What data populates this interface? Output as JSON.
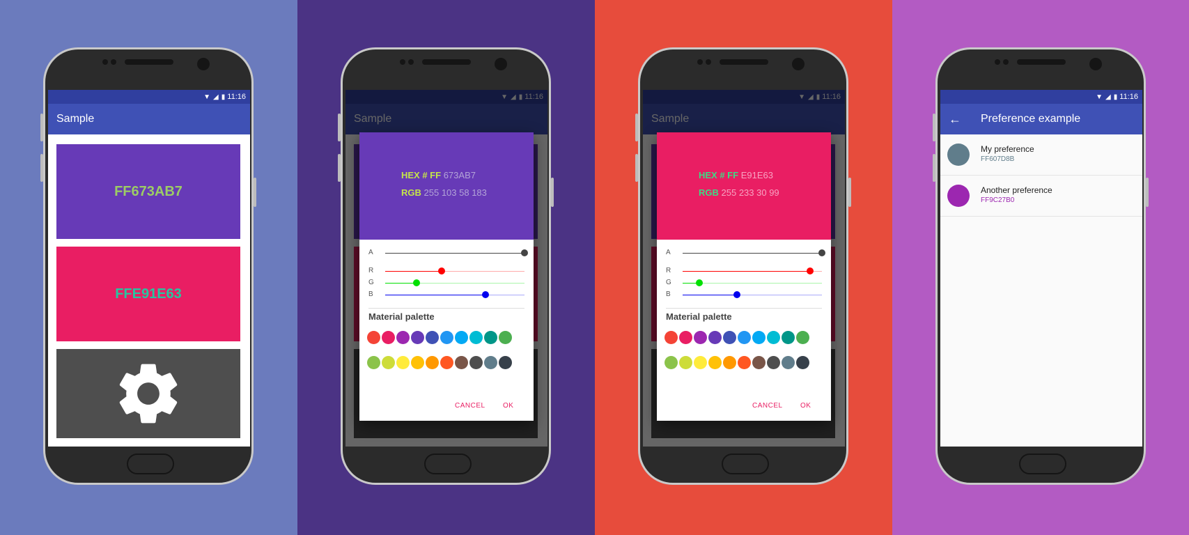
{
  "colors": {
    "bg": [
      "#6b7bbd",
      "#4b3384",
      "#e74c3c",
      "#b35bc3"
    ],
    "primary": "#3f51b5",
    "primary_dark": "#303f9f",
    "accent": "#e91e63",
    "slider_r": "#ff0000",
    "slider_g": "#00e000",
    "slider_b": "#0000ee",
    "slider_a": "#444444"
  },
  "status_bar": {
    "time": "11:16",
    "icons": [
      "wifi-icon",
      "signal-icon",
      "battery-icon"
    ]
  },
  "screen1": {
    "app_title": "Sample",
    "tiles": [
      {
        "label": "FF673AB7",
        "bg": "#673ab7",
        "text_color": "#9ccc65"
      },
      {
        "label": "FFE91E63",
        "bg": "#e91e63",
        "text_color": "#26c6a0"
      }
    ],
    "settings_tile": {
      "bg": "#4e4e4e",
      "icon": "gear-icon"
    }
  },
  "dialogs": [
    {
      "preview_bg": "#673ab7",
      "label_color": "#c4e54a",
      "value_color": "#b3a4d8",
      "hex_label": "HEX # FF",
      "hex_value": "673AB7",
      "rgb_label": "RGB",
      "rgb_value": "255 103 58 183",
      "sliders": {
        "A": 255,
        "R": 103,
        "G": 58,
        "B": 183
      },
      "slider_labels": [
        "A",
        "R",
        "G",
        "B"
      ],
      "palette_title": "Material palette",
      "cancel": "CANCEL",
      "ok": "OK"
    },
    {
      "preview_bg": "#e91e63",
      "label_color": "#3ddc84",
      "value_color": "#f8a3c2",
      "hex_label": "HEX # FF",
      "hex_value": "E91E63",
      "rgb_label": "RGB",
      "rgb_value": "255 233 30 99",
      "sliders": {
        "A": 255,
        "R": 233,
        "G": 30,
        "B": 99
      },
      "slider_labels": [
        "A",
        "R",
        "G",
        "B"
      ],
      "palette_title": "Material palette",
      "cancel": "CANCEL",
      "ok": "OK"
    }
  ],
  "palette_row1": [
    "#f44336",
    "#e91e63",
    "#9c27b0",
    "#673ab7",
    "#3f51b5",
    "#2196f3",
    "#03a9f4",
    "#00bcd4",
    "#009688",
    "#4caf50"
  ],
  "palette_row2": [
    "#8bc34a",
    "#cddc39",
    "#ffeb3b",
    "#ffc107",
    "#ff9800",
    "#ff5722",
    "#795548",
    "#4e4e4e",
    "#607d8b",
    "#37404a"
  ],
  "screen4": {
    "app_title": "Preference example",
    "back_icon": "arrow-back-icon",
    "prefs": [
      {
        "title": "My preference",
        "summary": "FF607D8B",
        "color": "#607d8b"
      },
      {
        "title": "Another preference",
        "summary": "FF9C27B0",
        "color": "#9c27b0"
      }
    ]
  }
}
